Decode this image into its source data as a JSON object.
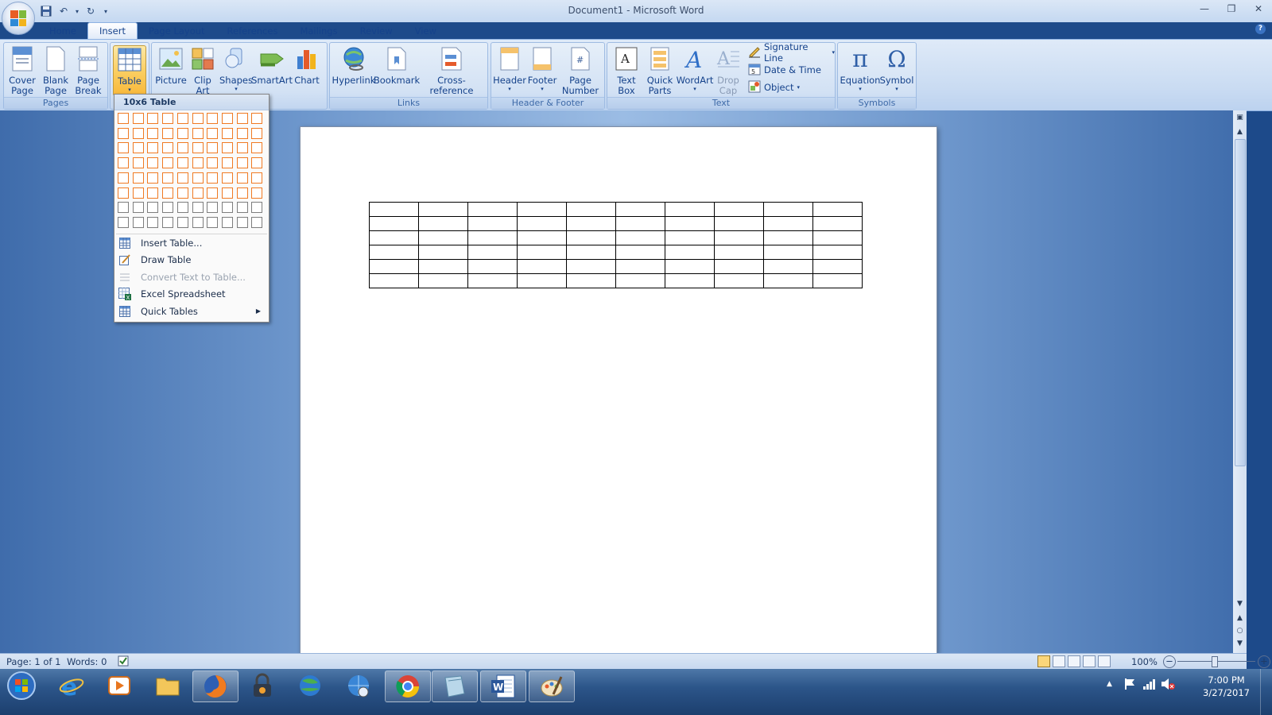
{
  "window": {
    "title": "Document1 - Microsoft Word"
  },
  "tabs": [
    {
      "label": "Home",
      "active": false
    },
    {
      "label": "Insert",
      "active": true
    },
    {
      "label": "Page Layout",
      "active": false
    },
    {
      "label": "References",
      "active": false
    },
    {
      "label": "Mailings",
      "active": false
    },
    {
      "label": "Review",
      "active": false
    },
    {
      "label": "View",
      "active": false
    }
  ],
  "ribbon": {
    "pages": {
      "label": "Pages",
      "cover_page": "Cover Page",
      "blank_page": "Blank Page",
      "page_break": "Page Break"
    },
    "tables": {
      "table": "Table"
    },
    "illustrations": {
      "picture": "Picture",
      "clip_art": "Clip Art",
      "shapes": "Shapes",
      "smartart": "SmartArt",
      "chart": "Chart"
    },
    "links": {
      "label": "Links",
      "hyperlink": "Hyperlink",
      "bookmark": "Bookmark",
      "cross_reference": "Cross-reference"
    },
    "header_footer": {
      "label": "Header & Footer",
      "header": "Header",
      "footer": "Footer",
      "page_number": "Page Number"
    },
    "text": {
      "label": "Text",
      "text_box": "Text Box",
      "quick_parts": "Quick Parts",
      "wordart": "WordArt",
      "drop_cap": "Drop Cap",
      "signature_line": "Signature Line",
      "date_time": "Date & Time",
      "object": "Object"
    },
    "symbols": {
      "label": "Symbols",
      "equation": "Equation",
      "symbol": "Symbol"
    }
  },
  "table_dropdown": {
    "header": "10x6 Table",
    "grid_cols": 10,
    "grid_rows": 8,
    "selected_cols": 10,
    "selected_rows": 6,
    "items": [
      {
        "label": "Insert Table...",
        "icon": "insert-table-icon",
        "disabled": false
      },
      {
        "label": "Draw Table",
        "icon": "draw-table-icon",
        "disabled": false
      },
      {
        "label": "Convert Text to Table...",
        "icon": "convert-text-icon",
        "disabled": true
      },
      {
        "label": "Excel Spreadsheet",
        "icon": "excel-icon",
        "disabled": false
      },
      {
        "label": "Quick Tables",
        "icon": "quick-tables-icon",
        "disabled": false,
        "submenu": true
      }
    ]
  },
  "document": {
    "table_cols": 10,
    "table_rows": 6
  },
  "statusbar": {
    "page": "Page: 1 of 1",
    "words": "Words: 0",
    "zoom": "100%"
  },
  "taskbar": {
    "apps": [
      "start-orb",
      "internet-explorer",
      "media-player",
      "file-explorer",
      "firefox",
      "vpn-lock",
      "globe-app",
      "network-globe",
      "chrome",
      "notes-app",
      "microsoft-word",
      "paint"
    ],
    "time": "7:00 PM",
    "date": "3/27/2017"
  }
}
